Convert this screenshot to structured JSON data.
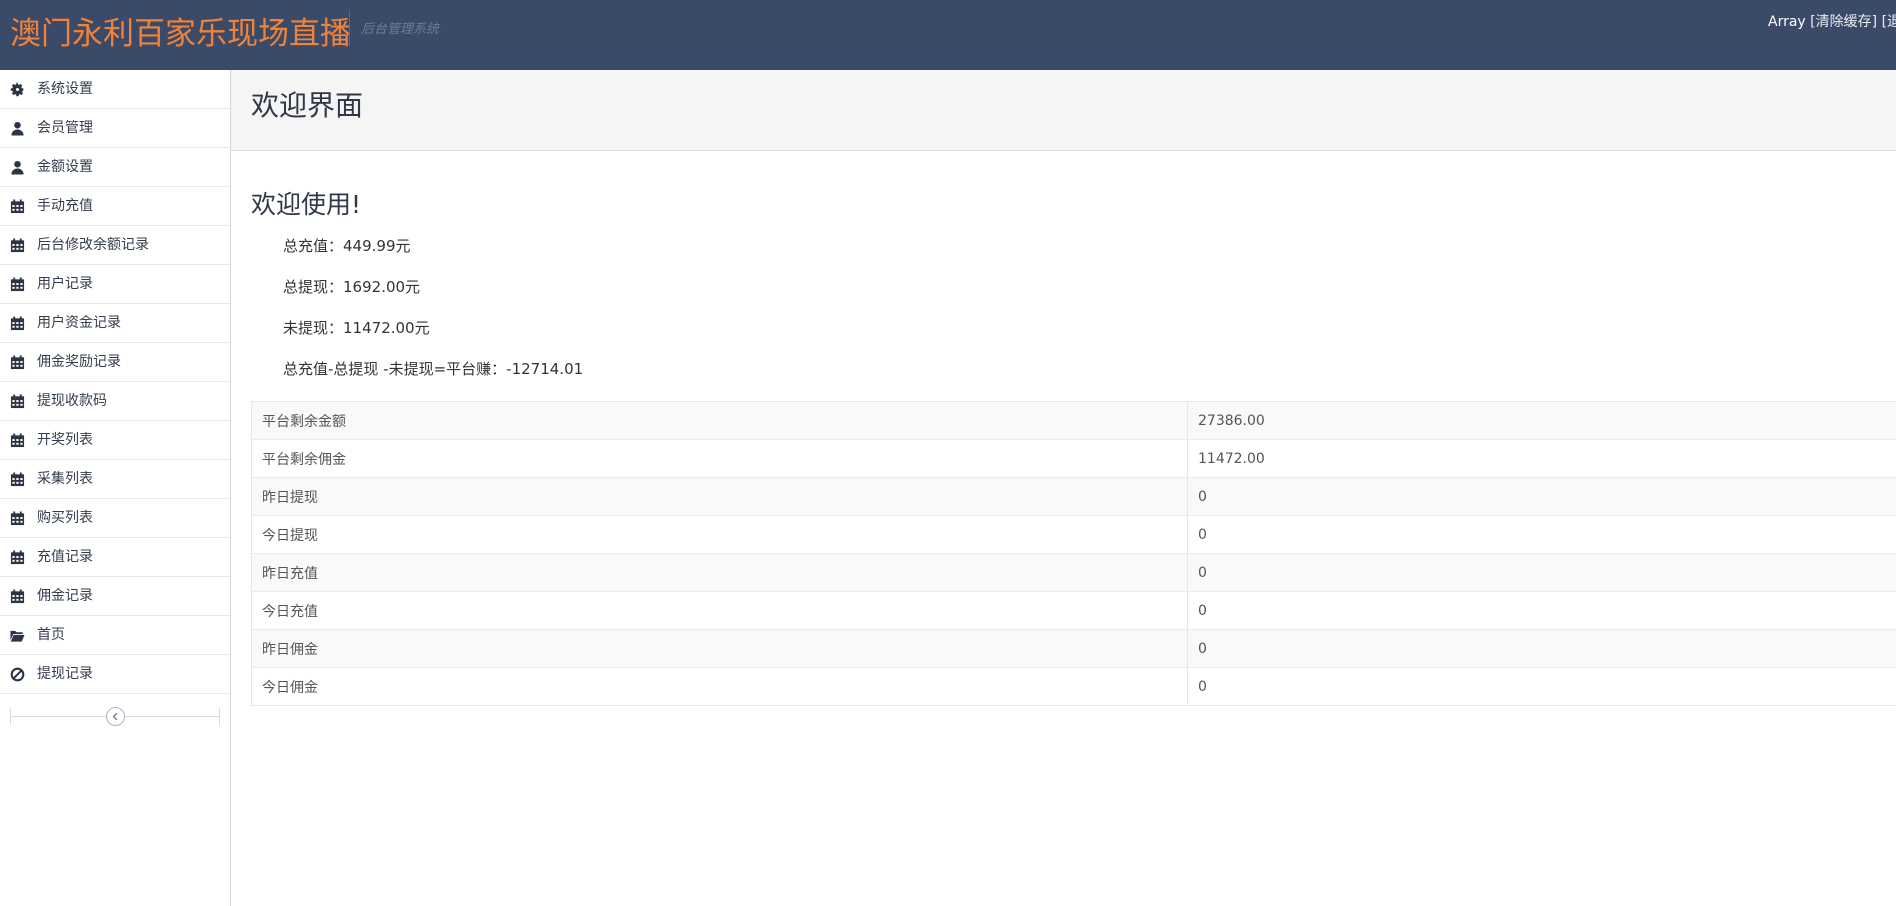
{
  "header": {
    "brand": "澳门永利百家乐现场直播",
    "subtitle": "后台管理系统",
    "user": "Array",
    "clear_cache": "[清除缓存]",
    "logout": "[退出]"
  },
  "sidebar": {
    "items": [
      {
        "label": "系统设置",
        "icon": "gear-icon"
      },
      {
        "label": "会员管理",
        "icon": "user-icon"
      },
      {
        "label": "金额设置",
        "icon": "user-icon"
      },
      {
        "label": "手动充值",
        "icon": "calendar-icon"
      },
      {
        "label": "后台修改余额记录",
        "icon": "calendar-icon"
      },
      {
        "label": "用户记录",
        "icon": "calendar-icon"
      },
      {
        "label": "用户资金记录",
        "icon": "calendar-icon"
      },
      {
        "label": "佣金奖励记录",
        "icon": "calendar-icon"
      },
      {
        "label": "提现收款码",
        "icon": "calendar-icon"
      },
      {
        "label": "开奖列表",
        "icon": "calendar-icon"
      },
      {
        "label": "采集列表",
        "icon": "calendar-icon"
      },
      {
        "label": "购买列表",
        "icon": "calendar-icon"
      },
      {
        "label": "充值记录",
        "icon": "calendar-icon"
      },
      {
        "label": "佣金记录",
        "icon": "calendar-icon"
      },
      {
        "label": "首页",
        "icon": "folder-open-icon"
      },
      {
        "label": "提现记录",
        "icon": "ban-icon"
      }
    ],
    "collapse_icon": "chevron-left-icon"
  },
  "main": {
    "page_title": "欢迎界面",
    "welcome": "欢迎使用!",
    "stats": [
      {
        "label": "总充值：",
        "value": "449.99元"
      },
      {
        "label": "总提现：",
        "value": "1692.00元"
      },
      {
        "label": "未提现：",
        "value": "11472.00元"
      },
      {
        "label": "总充值-总提现 -未提现=平台赚：",
        "value": "-12714.01"
      }
    ],
    "table": [
      {
        "key": "平台剩余金额",
        "value": "27386.00"
      },
      {
        "key": "平台剩余佣金",
        "value": "11472.00"
      },
      {
        "key": "昨日提现",
        "value": "0"
      },
      {
        "key": "今日提现",
        "value": "0"
      },
      {
        "key": "昨日充值",
        "value": "0"
      },
      {
        "key": "今日充值",
        "value": "0"
      },
      {
        "key": "昨日佣金",
        "value": "0"
      },
      {
        "key": "今日佣金",
        "value": "0"
      }
    ]
  },
  "colors": {
    "navbar_bg": "#3b4a68",
    "brand": "#f0823a",
    "page_header_bg": "#f5f5f5"
  }
}
